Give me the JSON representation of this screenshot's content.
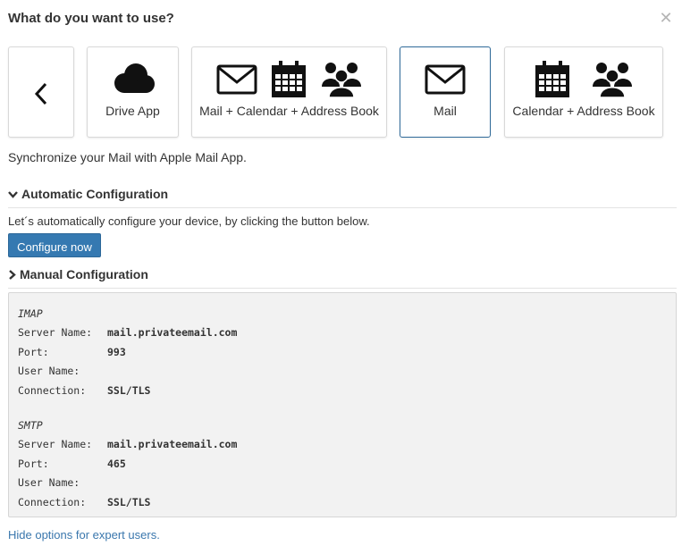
{
  "header": {
    "title": "What do you want to use?"
  },
  "cards": [
    {
      "label": "",
      "icons": [
        "chevron-left-icon"
      ]
    },
    {
      "label": "Drive App",
      "icons": [
        "cloud-icon"
      ]
    },
    {
      "label": "Mail + Calendar + Address Book",
      "icons": [
        "envelope-icon",
        "calendar-icon",
        "users-icon"
      ]
    },
    {
      "label": "Mail",
      "icons": [
        "envelope-icon"
      ],
      "selected": true
    },
    {
      "label": "Calendar + Address Book",
      "icons": [
        "calendar-icon",
        "users-icon"
      ]
    }
  ],
  "description": "Synchronize your Mail with Apple Mail App.",
  "automatic": {
    "title": "Automatic Configuration",
    "text": "Let´s automatically configure your device, by clicking the button below.",
    "button_label": "Configure now"
  },
  "manual": {
    "title": "Manual Configuration",
    "imap": {
      "heading": "IMAP",
      "server_label": "Server Name:",
      "server_value": "mail.privateemail.com",
      "port_label": "Port:",
      "port_value": "993",
      "user_label": "User Name:",
      "user_value": "",
      "conn_label": "Connection:",
      "conn_value": "SSL/TLS"
    },
    "smtp": {
      "heading": "SMTP",
      "server_label": "Server Name:",
      "server_value": "mail.privateemail.com",
      "port_label": "Port:",
      "port_value": "465",
      "user_label": "User Name:",
      "user_value": "",
      "conn_label": "Connection:",
      "conn_value": "SSL/TLS"
    }
  },
  "footer_link": "Hide options for expert users.",
  "colors": {
    "accent": "#3579b1",
    "link": "#3a77ad",
    "selected_border": "#2f6a99",
    "box_bg": "#f2f2f2"
  }
}
